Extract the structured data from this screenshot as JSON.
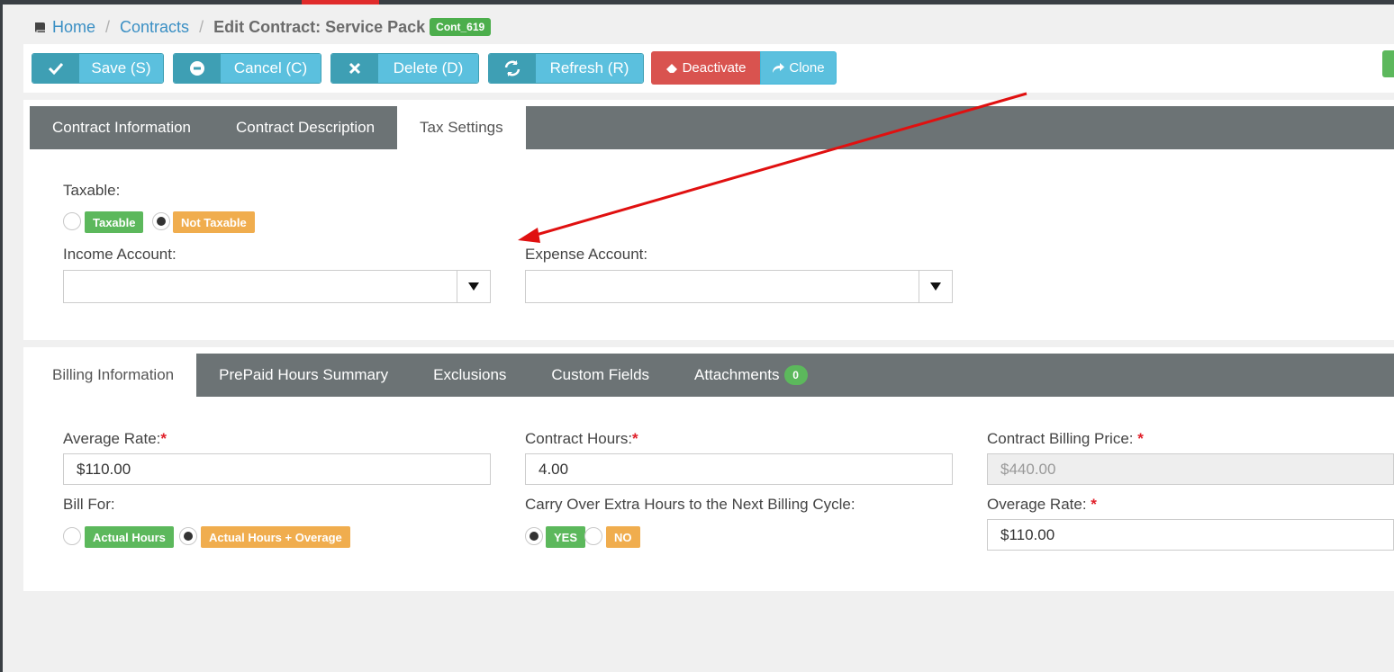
{
  "breadcrumb": {
    "home": "Home",
    "contracts": "Contracts",
    "current": "Edit Contract: Service Pack",
    "badge": "Cont_619"
  },
  "toolbar": {
    "save": "Save (S)",
    "cancel": "Cancel (C)",
    "delete": "Delete (D)",
    "refresh": "Refresh (R)",
    "deactivate": "Deactivate",
    "clone": "Clone"
  },
  "top_tabs": [
    "Contract Information",
    "Contract Description",
    "Tax Settings"
  ],
  "tax": {
    "taxable_label": "Taxable:",
    "taxable_option": "Taxable",
    "not_taxable_option": "Not Taxable",
    "selected": "Not Taxable",
    "income_label": "Income Account:",
    "income_value": "",
    "expense_label": "Expense Account:",
    "expense_value": ""
  },
  "bottom_tabs": {
    "billing": "Billing Information",
    "prepaid": "PrePaid Hours Summary",
    "exclusions": "Exclusions",
    "custom": "Custom Fields",
    "attachments": "Attachments",
    "attachments_count": "0"
  },
  "billing": {
    "avg_rate_label": "Average Rate:",
    "avg_rate_value": "$110.00",
    "contract_hours_label": "Contract Hours:",
    "contract_hours_value": "4.00",
    "billing_price_label": "Contract Billing Price:",
    "billing_price_value": "$440.00",
    "bill_for_label": "Bill For:",
    "bill_for_opt1": "Actual Hours",
    "bill_for_opt2": "Actual Hours + Overage",
    "bill_for_selected": "Actual Hours + Overage",
    "carry_label": "Carry Over Extra Hours to the Next Billing Cycle:",
    "carry_yes": "YES",
    "carry_no": "NO",
    "carry_selected": "YES",
    "overage_label": "Overage Rate:",
    "overage_value": "$110.00",
    "required_mark": "*"
  },
  "colors": {
    "accent": "#5bc0de",
    "danger": "#d9534f",
    "success": "#5cb85c",
    "warning": "#f0ad4e",
    "tab_bar": "#6c7375",
    "annotation_arrow": "#e01010"
  }
}
